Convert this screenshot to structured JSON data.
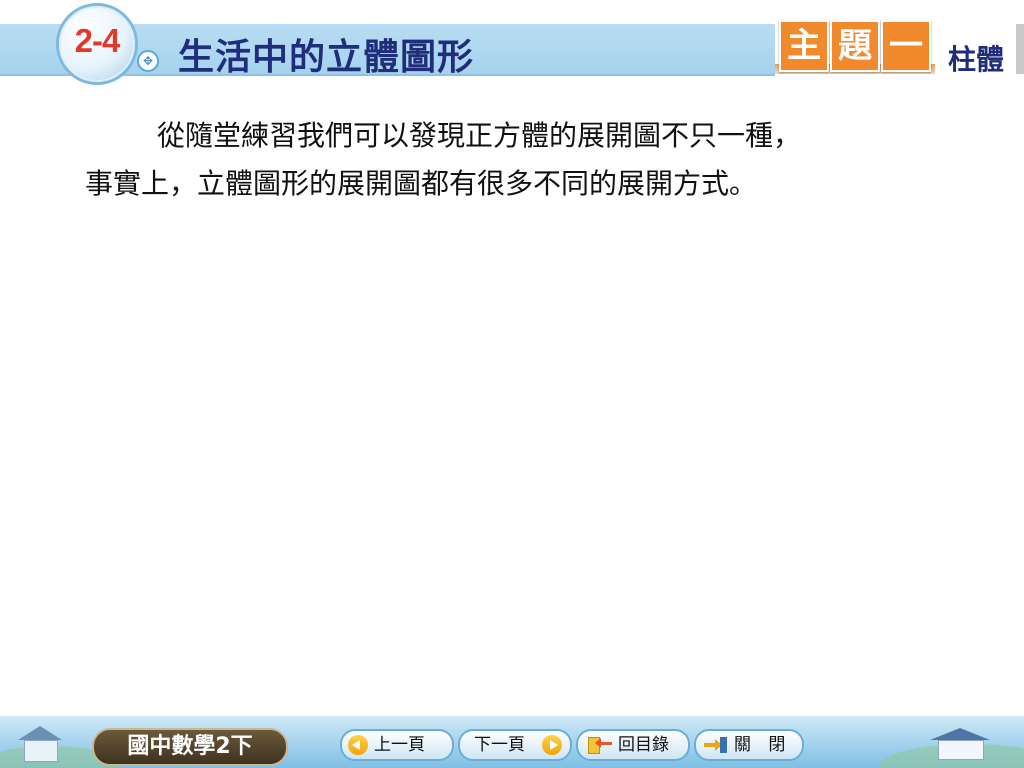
{
  "header": {
    "section_number": "2-4",
    "section_title": "生活中的立體圖形",
    "topic_chars": [
      "主",
      "題",
      "一"
    ],
    "topic_name": "柱體"
  },
  "content": {
    "paragraph_lines": [
      "從隨堂練習我們可以發現正方體的展開圖不只一種，",
      "事實上，立體圖形的展開圖都有很多不同的展開方式。"
    ]
  },
  "footer": {
    "book_title": "國中數學2下",
    "prev_label": "上一頁",
    "next_label": "下一頁",
    "toc_label": "回目錄",
    "close_label": "關 閉"
  },
  "colors": {
    "header_band": "#a5d2ee",
    "section_number": "#e23a2a",
    "title_text": "#1f2d7a",
    "topic_box": "#f08a2c",
    "nav_arrow": "#f2a20c"
  },
  "icons": [
    "prev-arrow-icon",
    "next-arrow-icon",
    "toc-icon",
    "exit-icon",
    "compass-icon"
  ]
}
